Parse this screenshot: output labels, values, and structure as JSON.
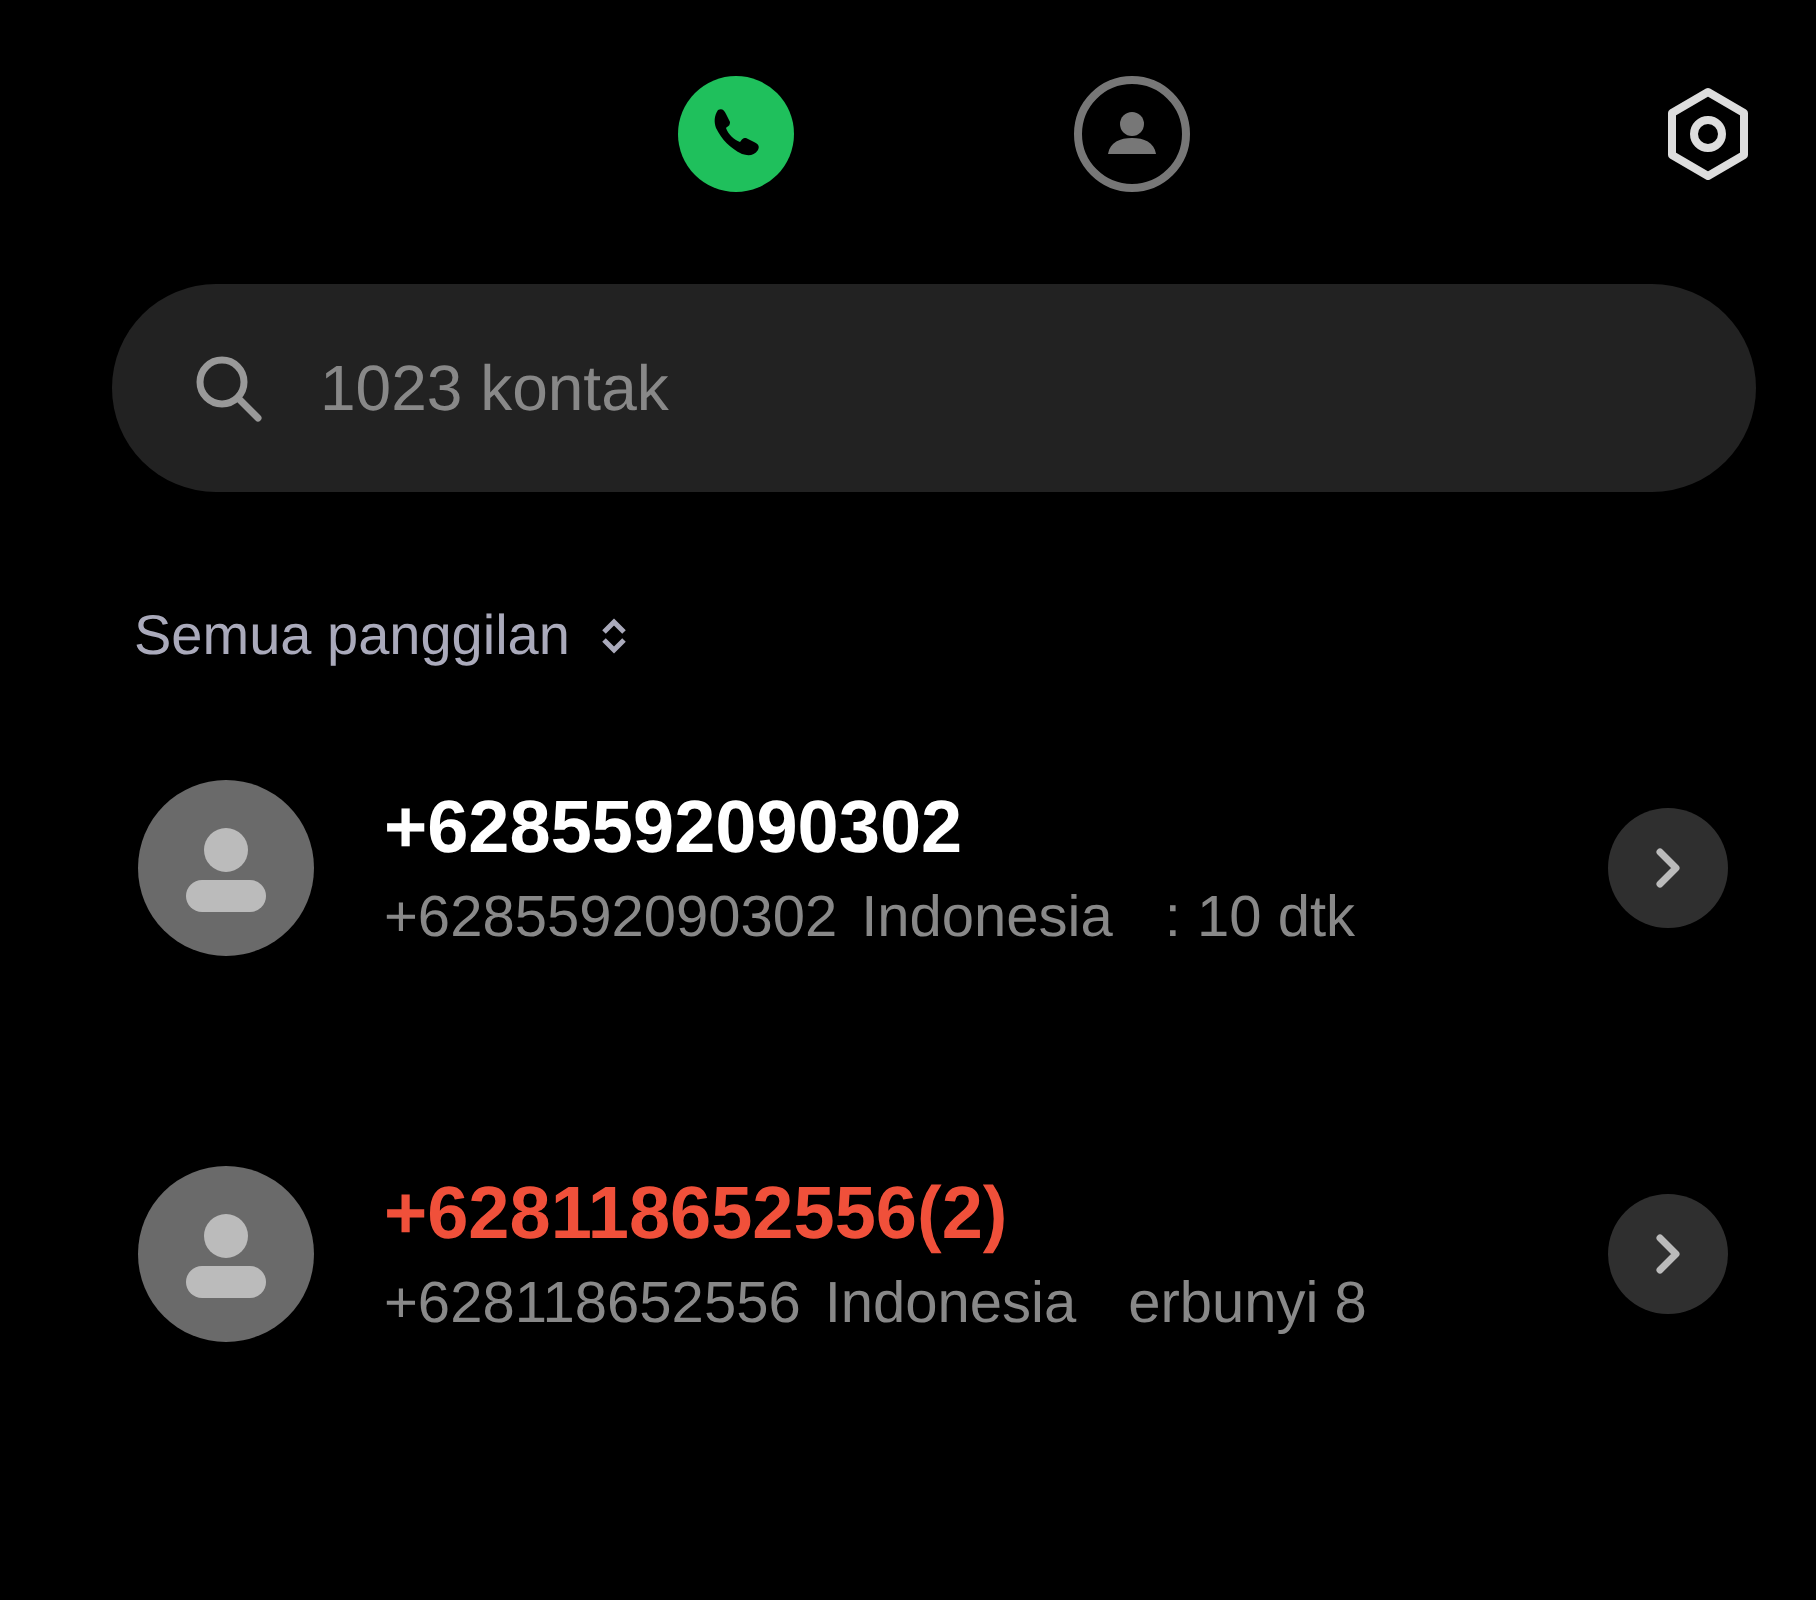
{
  "tabs": [
    {
      "kind": "calls",
      "selected": true
    },
    {
      "kind": "contacts",
      "selected": false
    }
  ],
  "search": {
    "placeholder": "1023 kontak"
  },
  "filter": {
    "label": "Semua panggilan"
  },
  "calls": [
    {
      "name": "+6285592090302",
      "missed": false,
      "number": "+6285592090302",
      "location": "Indonesia",
      "detail": ": 10 dtk"
    },
    {
      "name": "+628118652556(2)",
      "missed": true,
      "number": "+628118652556",
      "location": "Indonesia",
      "detail": "erbunyi 8"
    }
  ]
}
